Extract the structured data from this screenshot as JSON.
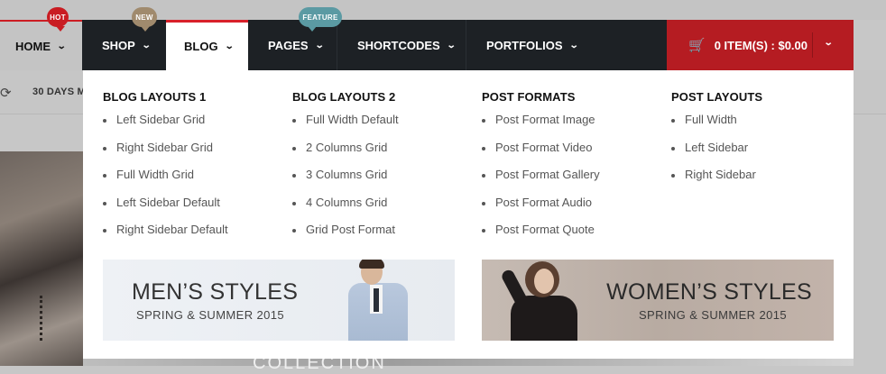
{
  "nav": {
    "home": "HOME",
    "shop": "SHOP",
    "blog": "BLOG",
    "pages": "PAGES",
    "shortcodes": "SHORTCODES",
    "portfolios": "PORTFOLIOS",
    "badges": {
      "hot": "HOT",
      "new": "NEW",
      "feature": "FEATURE"
    },
    "cart": "0 ITEM(S) : $0.00"
  },
  "background": {
    "promo": "30 DAYS M",
    "collection": "COLLECTION"
  },
  "menu": {
    "columns": [
      {
        "title": "BLOG LAYOUTS 1",
        "items": [
          "Left Sidebar Grid",
          "Right Sidebar Grid",
          "Full Width Grid",
          "Left Sidebar Default",
          "Right Sidebar Default"
        ]
      },
      {
        "title": "BLOG LAYOUTS 2",
        "items": [
          "Full Width Default",
          "2 Columns Grid",
          "3 Columns Grid",
          "4 Columns Grid",
          "Grid Post Format"
        ]
      },
      {
        "title": "POST FORMATS",
        "items": [
          "Post Format Image",
          "Post Format Video",
          "Post Format Gallery",
          "Post Format Audio",
          "Post Format Quote"
        ]
      },
      {
        "title": "POST LAYOUTS",
        "items": [
          "Full Width",
          "Left Sidebar",
          "Right Sidebar"
        ]
      }
    ],
    "banners": {
      "men": {
        "title": "MEN’S STYLES",
        "subtitle": "SPRING & SUMMER 2015"
      },
      "women": {
        "title": "WOMEN’S STYLES",
        "subtitle": "SPRING & SUMMER 2015"
      }
    }
  },
  "colors": {
    "nav_dark": "#1d2125",
    "cart_red": "#b51c22",
    "active_border": "#d8202a",
    "badge_hot": "#c91c22",
    "badge_new": "#a08a6d",
    "badge_feature": "#5b9aa3"
  },
  "icons": {
    "cart": "shopping-cart-icon",
    "chevron": "chevron-down-icon",
    "repeat": "repeat-icon"
  }
}
